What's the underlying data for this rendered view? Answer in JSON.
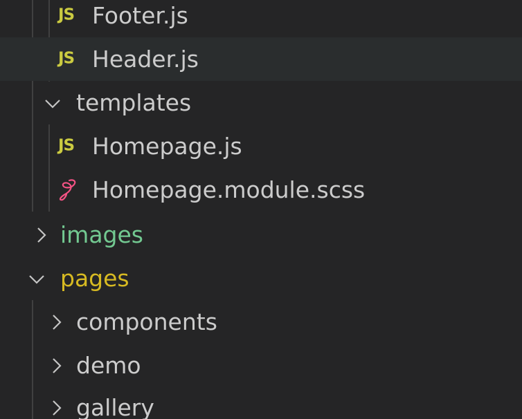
{
  "colors": {
    "background": "#252526",
    "hover_row": "#2a2d2e",
    "text": "#cccccc",
    "js_icon": "#cbcb41",
    "sass_icon": "#f55385",
    "folder_images": "#73c991",
    "folder_pages": "#d7ba22",
    "indent_guide": "#404040"
  },
  "icons": {
    "js": "JS",
    "sass": "sass-icon",
    "collapsed": "chevron-right-icon",
    "expanded": "chevron-down-icon"
  },
  "tree": [
    {
      "label": "Footer.js",
      "kind": "js-file"
    },
    {
      "label": "Header.js",
      "kind": "js-file",
      "hovered": true
    },
    {
      "label": "templates",
      "kind": "folder",
      "expanded": true
    },
    {
      "label": "Homepage.js",
      "kind": "js-file"
    },
    {
      "label": "Homepage.module.scss",
      "kind": "sass-file"
    },
    {
      "label": "images",
      "kind": "folder",
      "expanded": false
    },
    {
      "label": "pages",
      "kind": "folder",
      "expanded": true
    },
    {
      "label": "components",
      "kind": "folder",
      "expanded": false
    },
    {
      "label": "demo",
      "kind": "folder",
      "expanded": false
    },
    {
      "label": "gallery",
      "kind": "folder",
      "expanded": false
    }
  ]
}
